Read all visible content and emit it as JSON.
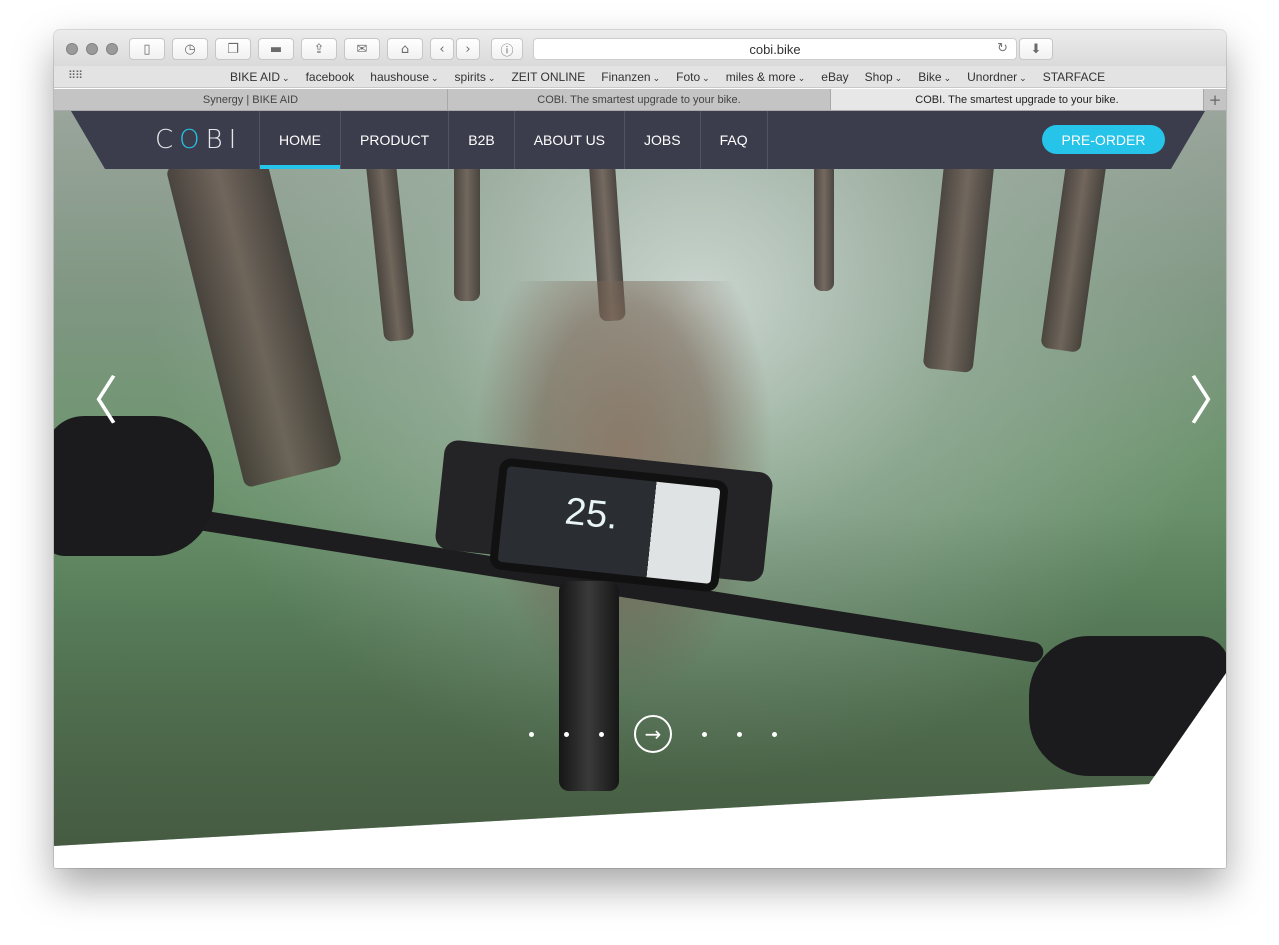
{
  "browser": {
    "url": "cobi.bike",
    "bookmarks": [
      {
        "label": "BIKE AID",
        "dropdown": true
      },
      {
        "label": "facebook",
        "dropdown": false
      },
      {
        "label": "haushouse",
        "dropdown": true
      },
      {
        "label": "spirits",
        "dropdown": true
      },
      {
        "label": "ZEIT ONLINE",
        "dropdown": false
      },
      {
        "label": "Finanzen",
        "dropdown": true
      },
      {
        "label": "Foto",
        "dropdown": true
      },
      {
        "label": "miles & more",
        "dropdown": true
      },
      {
        "label": "eBay",
        "dropdown": false
      },
      {
        "label": "Shop",
        "dropdown": true
      },
      {
        "label": "Bike",
        "dropdown": true
      },
      {
        "label": "Unordner",
        "dropdown": true
      },
      {
        "label": "STARFACE",
        "dropdown": false
      }
    ],
    "tabs": [
      {
        "title": "Synergy | BIKE AID"
      },
      {
        "title": "COBI. The smartest upgrade to your bike."
      },
      {
        "title": "COBI. The smartest upgrade to your bike."
      }
    ],
    "add_tab": "+",
    "toolbar_icons": [
      "sidebar-icon",
      "history-icon",
      "tabs-overview-icon",
      "print-icon",
      "share-icon",
      "mail-icon",
      "home-icon",
      "back-icon",
      "forward-icon",
      "privacy-icon",
      "reload-icon",
      "downloads-icon"
    ]
  },
  "site": {
    "logo": {
      "part1": "C",
      "part2": "O",
      "part3": "BI"
    },
    "nav": [
      {
        "label": "HOME",
        "active": true
      },
      {
        "label": "PRODUCT",
        "active": false
      },
      {
        "label": "B2B",
        "active": false
      },
      {
        "label": "ABOUT US",
        "active": false
      },
      {
        "label": "JOBS",
        "active": false
      },
      {
        "label": "FAQ",
        "active": false
      }
    ],
    "cta": "PRE-ORDER",
    "accent_color": "#25c4e8",
    "nav_color": "#3b3d4c",
    "hero": {
      "phone_speed": "25.",
      "slider": {
        "active_index": 3,
        "count": 7
      }
    }
  }
}
